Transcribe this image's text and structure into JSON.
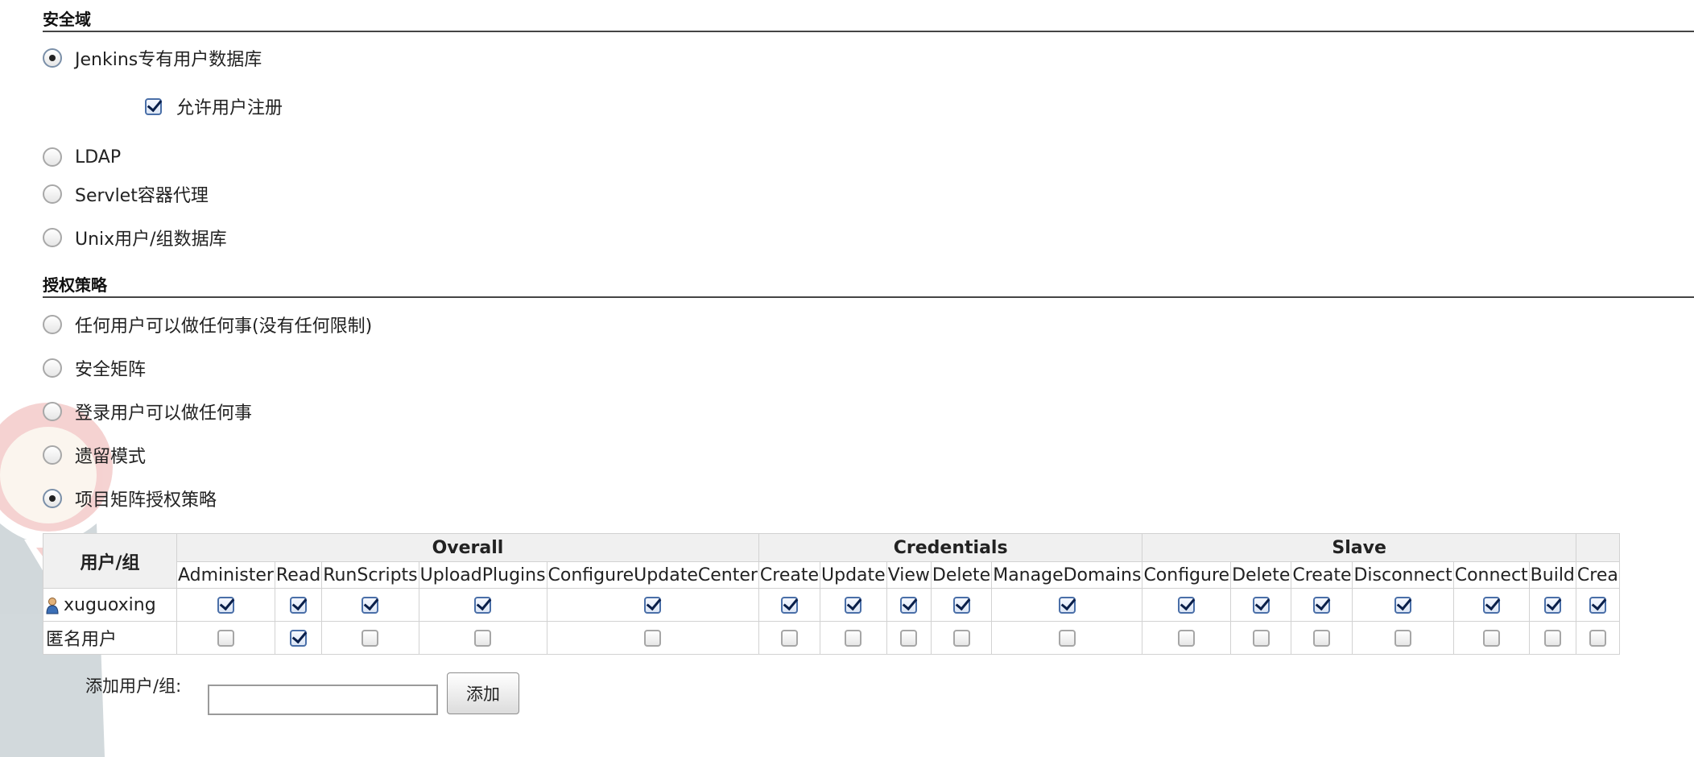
{
  "security_realm": {
    "title": "安全域",
    "options": [
      {
        "label": "Jenkins专有用户数据库",
        "selected": true
      },
      {
        "label": "LDAP",
        "selected": false
      },
      {
        "label": "Servlet容器代理",
        "selected": false
      },
      {
        "label": "Unix用户/组数据库",
        "selected": false
      }
    ],
    "allow_signup": {
      "label": "允许用户注册",
      "checked": true
    }
  },
  "authorization": {
    "title": "授权策略",
    "options": [
      {
        "label": "任何用户可以做任何事(没有任何限制)",
        "selected": false
      },
      {
        "label": "安全矩阵",
        "selected": false
      },
      {
        "label": "登录用户可以做任何事",
        "selected": false
      },
      {
        "label": "遗留模式",
        "selected": false
      },
      {
        "label": "项目矩阵授权策略",
        "selected": true
      }
    ]
  },
  "matrix": {
    "user_group_header": "用户/组",
    "groups": [
      {
        "name": "Overall",
        "permissions": [
          "Administer",
          "Read",
          "RunScripts",
          "UploadPlugins",
          "ConfigureUpdateCenter"
        ]
      },
      {
        "name": "Credentials",
        "permissions": [
          "Create",
          "Update",
          "View",
          "Delete",
          "ManageDomains"
        ]
      },
      {
        "name": "Slave",
        "permissions": [
          "Configure",
          "Delete",
          "Create",
          "Disconnect",
          "Connect",
          "Build"
        ]
      },
      {
        "name": "",
        "permissions": [
          "Crea"
        ]
      }
    ],
    "rows": [
      {
        "name": "xuguoxing",
        "icon": "user-icon",
        "checks": [
          true,
          true,
          true,
          true,
          true,
          true,
          true,
          true,
          true,
          true,
          true,
          true,
          true,
          true,
          true,
          true,
          true
        ]
      },
      {
        "name": "匿名用户",
        "icon": "",
        "checks": [
          false,
          true,
          false,
          false,
          false,
          false,
          false,
          false,
          false,
          false,
          false,
          false,
          false,
          false,
          false,
          false,
          false
        ]
      }
    ]
  },
  "add_user": {
    "label": "添加用户/组:",
    "value": "",
    "button": "添加"
  },
  "colors": {
    "header_bg": "#f0f0f0",
    "check": "#0a1f4a",
    "watermark": "#d9362b"
  }
}
